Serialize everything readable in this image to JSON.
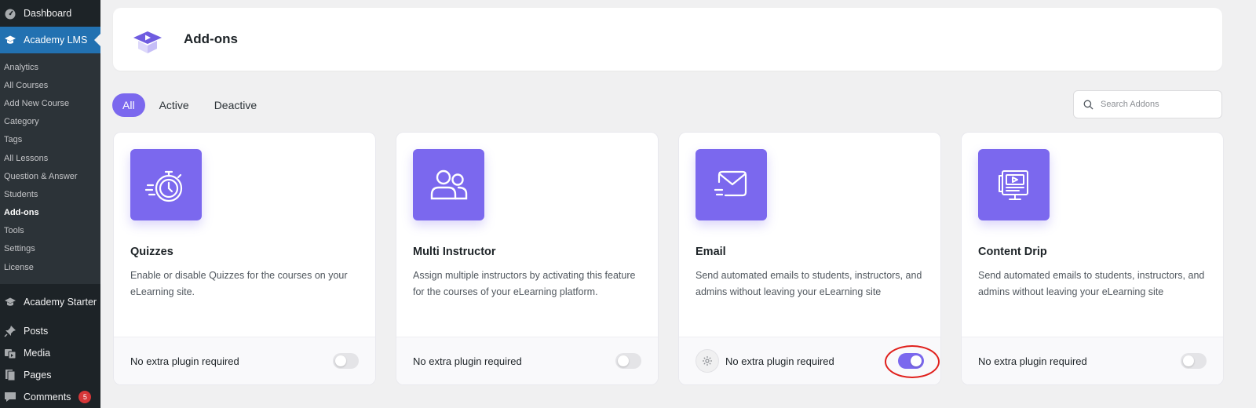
{
  "sidebar": {
    "dashboard": "Dashboard",
    "academy_lms": "Academy LMS",
    "sub_items": [
      {
        "label": "Analytics"
      },
      {
        "label": "All Courses"
      },
      {
        "label": "Add New Course"
      },
      {
        "label": "Category"
      },
      {
        "label": "Tags"
      },
      {
        "label": "All Lessons"
      },
      {
        "label": "Question & Answer"
      },
      {
        "label": "Students"
      },
      {
        "label": "Add-ons"
      },
      {
        "label": "Tools"
      },
      {
        "label": "Settings"
      },
      {
        "label": "License"
      }
    ],
    "current_sub_item": "Add-ons",
    "academy_starter": "Academy Starter",
    "posts": "Posts",
    "media": "Media",
    "pages": "Pages",
    "comments": "Comments",
    "comments_badge": "5"
  },
  "header": {
    "title": "Add-ons",
    "logo_icon": "graduation-cap-icon"
  },
  "filters": {
    "tabs": [
      {
        "label": "All"
      },
      {
        "label": "Active"
      },
      {
        "label": "Deactive"
      }
    ],
    "active_tab": "All"
  },
  "search": {
    "placeholder": "Search Addons",
    "value": ""
  },
  "addons": [
    {
      "title": "Quizzes",
      "description": "Enable or disable Quizzes for the courses on your eLearning site.",
      "footer": "No extra plugin required",
      "enabled": false,
      "icon": "stopwatch-icon"
    },
    {
      "title": "Multi Instructor",
      "description": "Assign multiple instructors by activating this feature for the courses of your eLearning platform.",
      "footer": "No extra plugin required",
      "enabled": false,
      "icon": "users-icon"
    },
    {
      "title": "Email",
      "description": "Send automated emails to students, instructors, and admins without leaving your eLearning site",
      "footer": "No extra plugin required",
      "enabled": true,
      "icon": "envelope-icon",
      "has_settings": true
    },
    {
      "title": "Content Drip",
      "description": "Send automated emails to students, instructors, and admins without leaving your eLearning site",
      "footer": "No extra plugin required",
      "enabled": false,
      "icon": "content-drip-icon"
    }
  ],
  "colors": {
    "accent": "#7b68ee",
    "sidebar_bg": "#1d2327",
    "sidebar_active": "#2271b1",
    "highlight": "#e0201c"
  }
}
